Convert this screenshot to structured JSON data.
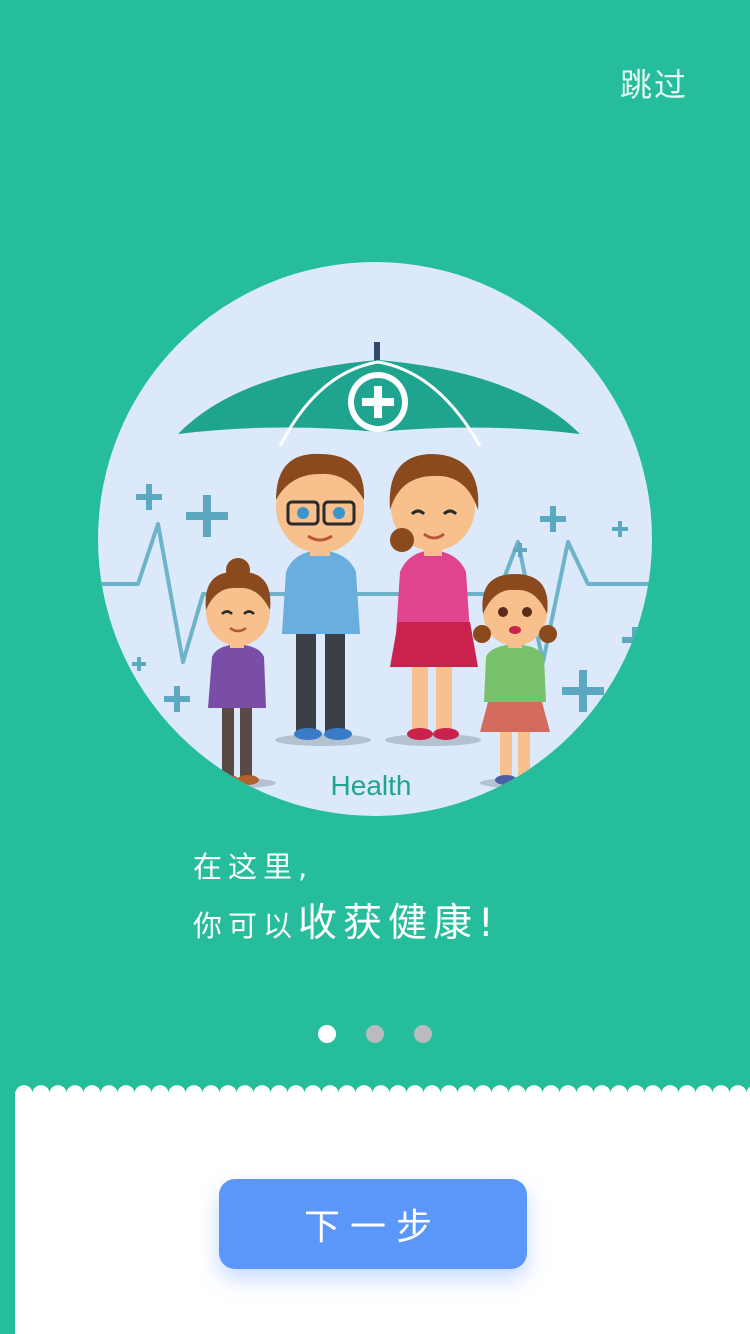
{
  "skip_label": "跳过",
  "illustration": {
    "label": "Health",
    "colors": {
      "circle": "#dbe9fb",
      "umbrella": "#1fa58f",
      "heartbeat": "#6db3c9"
    }
  },
  "caption": {
    "line1": "在这里,",
    "line2_small": "你可以",
    "line2_big": "收获健康!"
  },
  "pager": {
    "count": 3,
    "active_index": 0
  },
  "next_button_label": "下一步",
  "colors": {
    "background": "#26bd9c",
    "button": "#5b97f8",
    "dot_active": "#ffffff",
    "dot_inactive": "#b8bcbd"
  }
}
